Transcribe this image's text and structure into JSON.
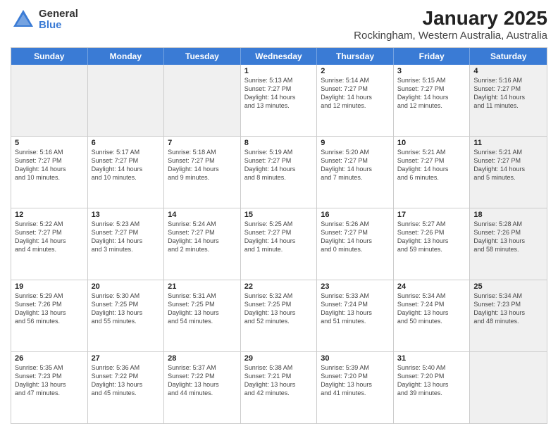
{
  "header": {
    "logo_general": "General",
    "logo_blue": "Blue",
    "title": "January 2025",
    "subtitle": "Rockingham, Western Australia, Australia"
  },
  "days_of_week": [
    "Sunday",
    "Monday",
    "Tuesday",
    "Wednesday",
    "Thursday",
    "Friday",
    "Saturday"
  ],
  "weeks": [
    [
      {
        "day": "",
        "info": "",
        "shade": true
      },
      {
        "day": "",
        "info": "",
        "shade": true
      },
      {
        "day": "",
        "info": "",
        "shade": true
      },
      {
        "day": "1",
        "info": "Sunrise: 5:13 AM\nSunset: 7:27 PM\nDaylight: 14 hours\nand 13 minutes.",
        "shade": false
      },
      {
        "day": "2",
        "info": "Sunrise: 5:14 AM\nSunset: 7:27 PM\nDaylight: 14 hours\nand 12 minutes.",
        "shade": false
      },
      {
        "day": "3",
        "info": "Sunrise: 5:15 AM\nSunset: 7:27 PM\nDaylight: 14 hours\nand 12 minutes.",
        "shade": false
      },
      {
        "day": "4",
        "info": "Sunrise: 5:16 AM\nSunset: 7:27 PM\nDaylight: 14 hours\nand 11 minutes.",
        "shade": true
      }
    ],
    [
      {
        "day": "5",
        "info": "Sunrise: 5:16 AM\nSunset: 7:27 PM\nDaylight: 14 hours\nand 10 minutes.",
        "shade": false
      },
      {
        "day": "6",
        "info": "Sunrise: 5:17 AM\nSunset: 7:27 PM\nDaylight: 14 hours\nand 10 minutes.",
        "shade": false
      },
      {
        "day": "7",
        "info": "Sunrise: 5:18 AM\nSunset: 7:27 PM\nDaylight: 14 hours\nand 9 minutes.",
        "shade": false
      },
      {
        "day": "8",
        "info": "Sunrise: 5:19 AM\nSunset: 7:27 PM\nDaylight: 14 hours\nand 8 minutes.",
        "shade": false
      },
      {
        "day": "9",
        "info": "Sunrise: 5:20 AM\nSunset: 7:27 PM\nDaylight: 14 hours\nand 7 minutes.",
        "shade": false
      },
      {
        "day": "10",
        "info": "Sunrise: 5:21 AM\nSunset: 7:27 PM\nDaylight: 14 hours\nand 6 minutes.",
        "shade": false
      },
      {
        "day": "11",
        "info": "Sunrise: 5:21 AM\nSunset: 7:27 PM\nDaylight: 14 hours\nand 5 minutes.",
        "shade": true
      }
    ],
    [
      {
        "day": "12",
        "info": "Sunrise: 5:22 AM\nSunset: 7:27 PM\nDaylight: 14 hours\nand 4 minutes.",
        "shade": false
      },
      {
        "day": "13",
        "info": "Sunrise: 5:23 AM\nSunset: 7:27 PM\nDaylight: 14 hours\nand 3 minutes.",
        "shade": false
      },
      {
        "day": "14",
        "info": "Sunrise: 5:24 AM\nSunset: 7:27 PM\nDaylight: 14 hours\nand 2 minutes.",
        "shade": false
      },
      {
        "day": "15",
        "info": "Sunrise: 5:25 AM\nSunset: 7:27 PM\nDaylight: 14 hours\nand 1 minute.",
        "shade": false
      },
      {
        "day": "16",
        "info": "Sunrise: 5:26 AM\nSunset: 7:27 PM\nDaylight: 14 hours\nand 0 minutes.",
        "shade": false
      },
      {
        "day": "17",
        "info": "Sunrise: 5:27 AM\nSunset: 7:26 PM\nDaylight: 13 hours\nand 59 minutes.",
        "shade": false
      },
      {
        "day": "18",
        "info": "Sunrise: 5:28 AM\nSunset: 7:26 PM\nDaylight: 13 hours\nand 58 minutes.",
        "shade": true
      }
    ],
    [
      {
        "day": "19",
        "info": "Sunrise: 5:29 AM\nSunset: 7:26 PM\nDaylight: 13 hours\nand 56 minutes.",
        "shade": false
      },
      {
        "day": "20",
        "info": "Sunrise: 5:30 AM\nSunset: 7:25 PM\nDaylight: 13 hours\nand 55 minutes.",
        "shade": false
      },
      {
        "day": "21",
        "info": "Sunrise: 5:31 AM\nSunset: 7:25 PM\nDaylight: 13 hours\nand 54 minutes.",
        "shade": false
      },
      {
        "day": "22",
        "info": "Sunrise: 5:32 AM\nSunset: 7:25 PM\nDaylight: 13 hours\nand 52 minutes.",
        "shade": false
      },
      {
        "day": "23",
        "info": "Sunrise: 5:33 AM\nSunset: 7:24 PM\nDaylight: 13 hours\nand 51 minutes.",
        "shade": false
      },
      {
        "day": "24",
        "info": "Sunrise: 5:34 AM\nSunset: 7:24 PM\nDaylight: 13 hours\nand 50 minutes.",
        "shade": false
      },
      {
        "day": "25",
        "info": "Sunrise: 5:34 AM\nSunset: 7:23 PM\nDaylight: 13 hours\nand 48 minutes.",
        "shade": true
      }
    ],
    [
      {
        "day": "26",
        "info": "Sunrise: 5:35 AM\nSunset: 7:23 PM\nDaylight: 13 hours\nand 47 minutes.",
        "shade": false
      },
      {
        "day": "27",
        "info": "Sunrise: 5:36 AM\nSunset: 7:22 PM\nDaylight: 13 hours\nand 45 minutes.",
        "shade": false
      },
      {
        "day": "28",
        "info": "Sunrise: 5:37 AM\nSunset: 7:22 PM\nDaylight: 13 hours\nand 44 minutes.",
        "shade": false
      },
      {
        "day": "29",
        "info": "Sunrise: 5:38 AM\nSunset: 7:21 PM\nDaylight: 13 hours\nand 42 minutes.",
        "shade": false
      },
      {
        "day": "30",
        "info": "Sunrise: 5:39 AM\nSunset: 7:20 PM\nDaylight: 13 hours\nand 41 minutes.",
        "shade": false
      },
      {
        "day": "31",
        "info": "Sunrise: 5:40 AM\nSunset: 7:20 PM\nDaylight: 13 hours\nand 39 minutes.",
        "shade": false
      },
      {
        "day": "",
        "info": "",
        "shade": true
      }
    ]
  ]
}
